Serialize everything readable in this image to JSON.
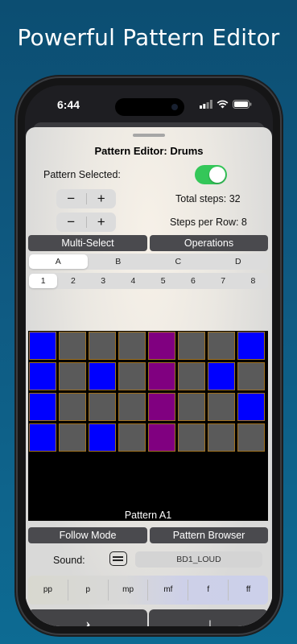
{
  "headline": "Powerful Pattern Editor",
  "status_bar": {
    "time": "6:44",
    "icons": [
      "signal-icon",
      "wifi-icon",
      "battery-icon"
    ]
  },
  "editor": {
    "title": "Pattern Editor: Drums",
    "pattern_selected_label": "Pattern Selected:",
    "pattern_selected_on": true,
    "stepper_minus": "−",
    "stepper_plus": "+",
    "total_steps": "Total steps: 32",
    "steps_per_row": "Steps per Row: 8",
    "multi_select": "Multi-Select",
    "operations": "Operations",
    "patterns": [
      "A",
      "B",
      "C",
      "D"
    ],
    "selected_pattern_index": 0,
    "steps": [
      "1",
      "2",
      "3",
      "4",
      "5",
      "6",
      "7",
      "8"
    ],
    "selected_step_index": 0,
    "grid_label": "Pattern A1",
    "follow_mode": "Follow Mode",
    "pattern_browser": "Pattern Browser",
    "sound_label": "Sound:",
    "sound_value": "BD1_LOUD",
    "dynamics": [
      "pp",
      "p",
      "mp",
      "mf",
      "f",
      "ff"
    ],
    "rest_symbol": "𝄽",
    "note_symbol": "♩"
  },
  "colors": {
    "blue_step": "#0000ff",
    "purple_step": "#800080",
    "off_step": "#5a5a5a",
    "toggle_on": "#34c759"
  },
  "grid": [
    [
      "blue",
      "off",
      "off",
      "off",
      "purple",
      "off",
      "off",
      "blue"
    ],
    [
      "blue",
      "off",
      "blue",
      "off",
      "purple",
      "off",
      "blue",
      "off"
    ],
    [
      "blue",
      "off",
      "off",
      "off",
      "purple",
      "off",
      "off",
      "blue"
    ],
    [
      "blue",
      "off",
      "blue",
      "off",
      "purple",
      "off",
      "off",
      "off"
    ]
  ]
}
